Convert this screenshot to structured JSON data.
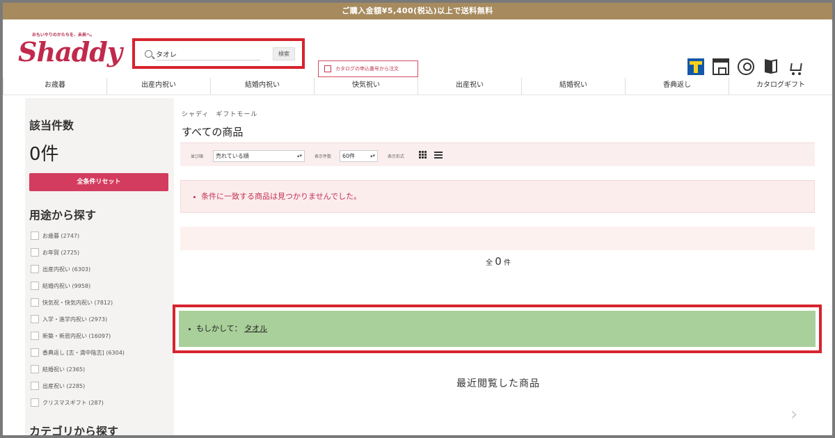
{
  "banner": {
    "text": "ご購入金額¥5,400(税込)以上で送料無料"
  },
  "header": {
    "logo_tagline": "おもいやりのかたちを、未来へ。",
    "logo": "Shaddy",
    "search": {
      "value": "タオレ",
      "button_label": "検索"
    },
    "catalog_button": "カタログの申込番号から注文",
    "icons": [
      "t-point-icon",
      "store-icon",
      "account-icon",
      "book-icon",
      "cart-icon"
    ]
  },
  "nav": {
    "items": [
      "お歳暮",
      "出産内祝い",
      "結婚内祝い",
      "快気祝い",
      "出産祝い",
      "結婚祝い",
      "香典返し",
      "カタログギフト"
    ]
  },
  "sidebar": {
    "count_title": "該当件数",
    "count": "0件",
    "reset_label": "全条件リセット",
    "purpose_title": "用途から探す",
    "purpose_items": [
      "お歳暮 (2747)",
      "お年賀 (2725)",
      "出産内祝い (6303)",
      "結婚内祝い (9958)",
      "快気祝・快気内祝い (7812)",
      "入学・進学内祝い (2973)",
      "新築・新居内祝い (16097)",
      "香典返し [志・満中陰志] (6304)",
      "結婚祝い (2365)",
      "出産祝い (2285)",
      "クリスマスギフト (287)"
    ],
    "category_title": "カテゴリから探す"
  },
  "main": {
    "breadcrumb": "シャディ　ギフトモール",
    "title": "すべての商品",
    "sort": {
      "order_label": "並び順",
      "order_value": "売れている順",
      "per_page_label": "表示件数",
      "per_page_value": "60件",
      "view_label": "表示形式"
    },
    "notice": "条件に一致する商品は見つかりませんでした。",
    "total_prefix": "全",
    "total_count": "0",
    "total_suffix": "件",
    "suggest_prefix": "もしかして：",
    "suggest_link": "タオル",
    "recent_title": "最近閲覧した商品"
  },
  "colors": {
    "brand": "#c02a4c",
    "banner": "#a78b5e",
    "highlight": "#d6242d",
    "suggest_bg": "#a9cf9a"
  }
}
